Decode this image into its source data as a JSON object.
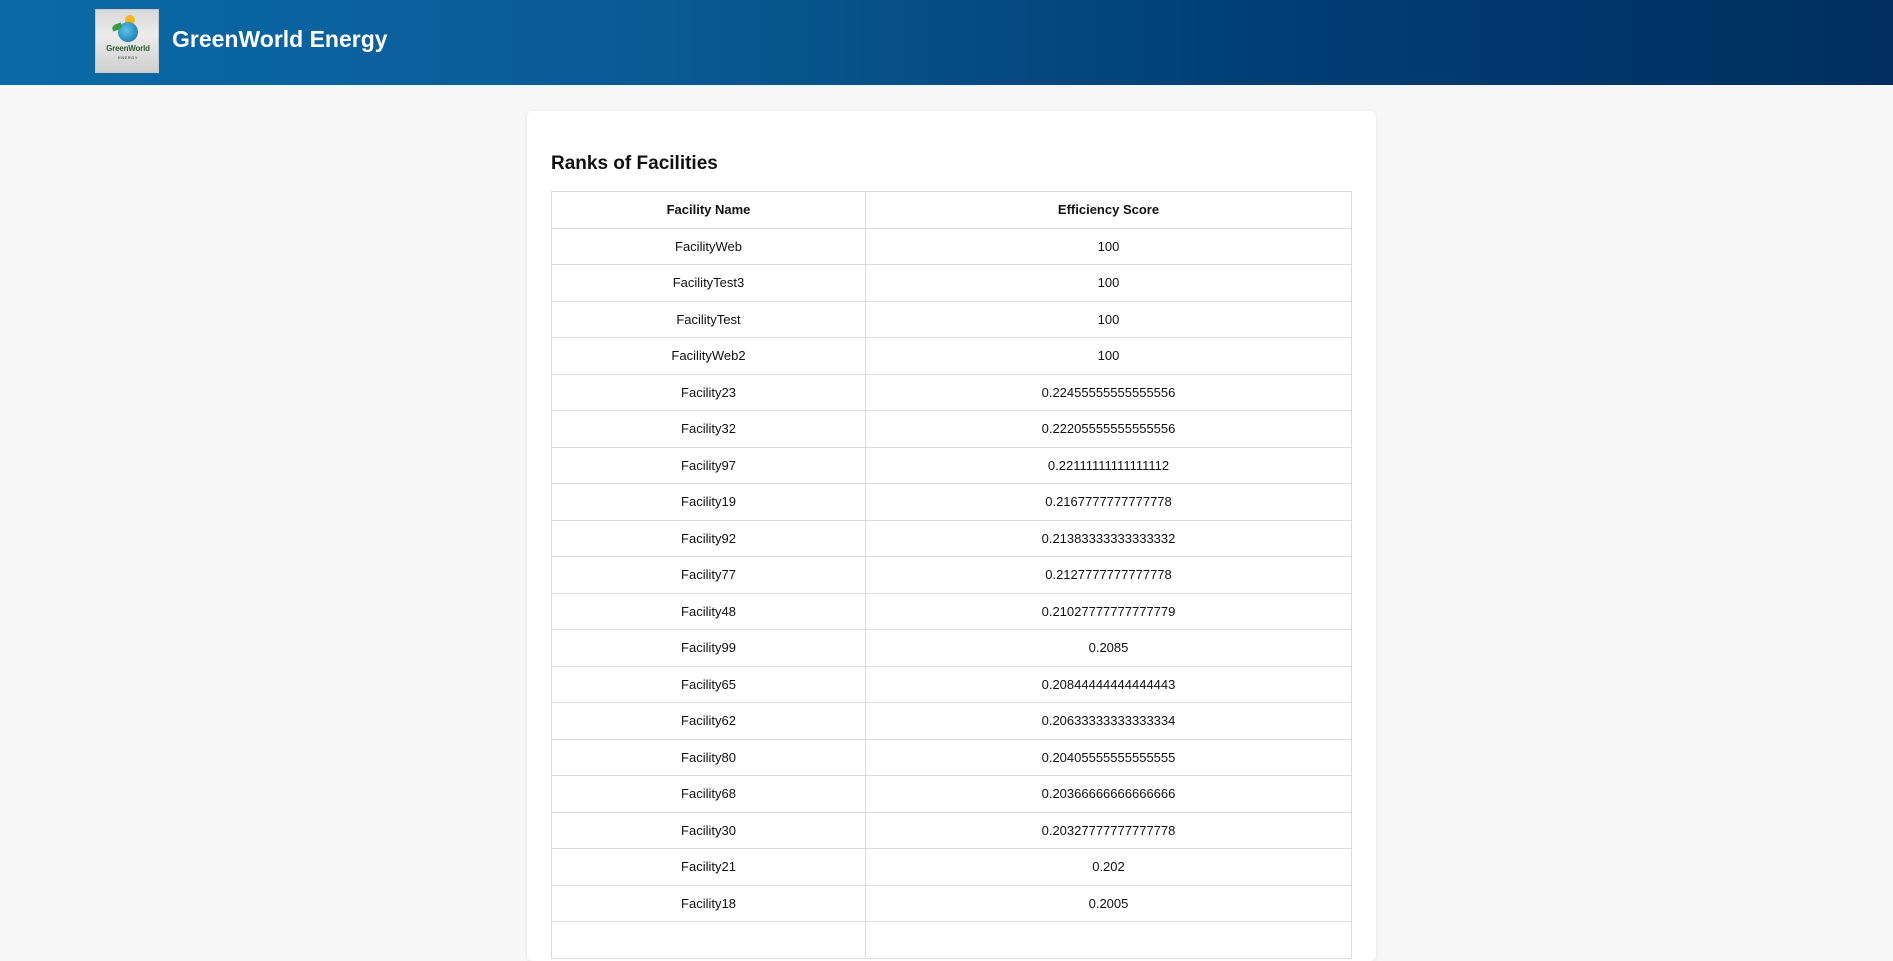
{
  "header": {
    "logo": {
      "brand_top": "GreenWorld",
      "brand_bottom": "ENERGY",
      "icon": "globe-sun-logo"
    },
    "title": "GreenWorld Energy",
    "colors": {
      "gradient_start": "#0a6aa8",
      "gradient_end": "#002e61"
    }
  },
  "main": {
    "heading": "Ranks of Facilities",
    "table": {
      "columns": [
        "Facility Name",
        "Efficiency Score"
      ],
      "rows": [
        [
          "FacilityWeb",
          "100"
        ],
        [
          "FacilityTest3",
          "100"
        ],
        [
          "FacilityTest",
          "100"
        ],
        [
          "FacilityWeb2",
          "100"
        ],
        [
          "Facility23",
          "0.22455555555555556"
        ],
        [
          "Facility32",
          "0.22205555555555556"
        ],
        [
          "Facility97",
          "0.22111111111111112"
        ],
        [
          "Facility19",
          "0.2167777777777778"
        ],
        [
          "Facility92",
          "0.21383333333333332"
        ],
        [
          "Facility77",
          "0.2127777777777778"
        ],
        [
          "Facility48",
          "0.21027777777777779"
        ],
        [
          "Facility99",
          "0.2085"
        ],
        [
          "Facility65",
          "0.20844444444444443"
        ],
        [
          "Facility62",
          "0.20633333333333334"
        ],
        [
          "Facility80",
          "0.20405555555555555"
        ],
        [
          "Facility68",
          "0.20366666666666666"
        ],
        [
          "Facility30",
          "0.20327777777777778"
        ],
        [
          "Facility21",
          "0.202"
        ],
        [
          "Facility18",
          "0.2005"
        ],
        [
          "",
          ""
        ]
      ]
    }
  }
}
